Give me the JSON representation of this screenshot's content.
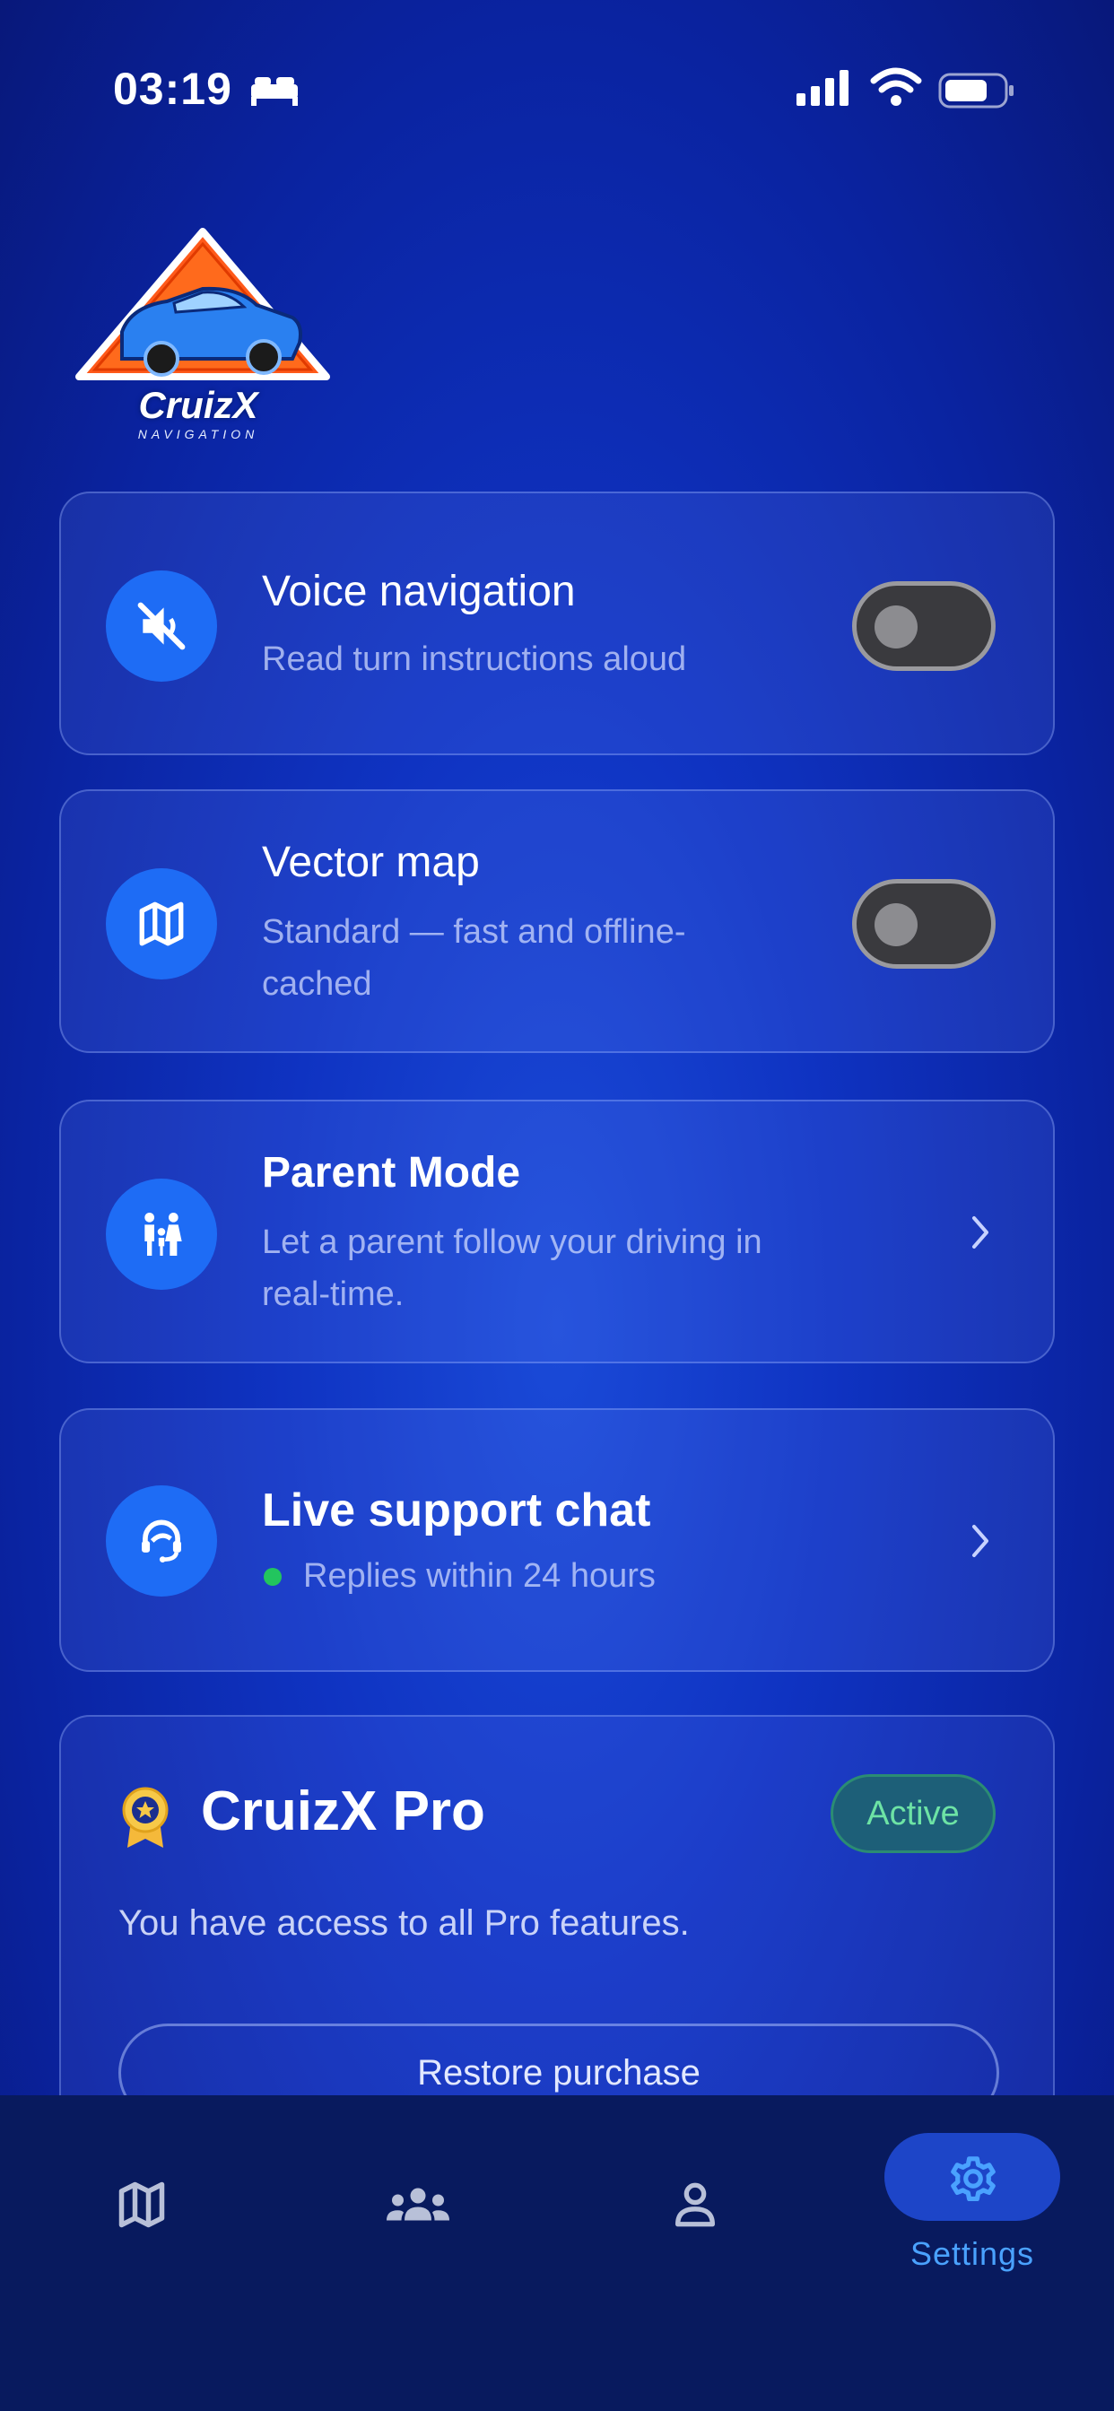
{
  "status_bar": {
    "time": "03:19"
  },
  "logo": {
    "title": "CruizX",
    "subtitle": "NAVIGATION"
  },
  "settings": [
    {
      "title": "Voice navigation",
      "subtitle": "Read turn instructions aloud",
      "control": "toggle",
      "enabled": false,
      "icon": "speaker-muted-icon"
    },
    {
      "title": "Vector map",
      "subtitle": "Standard — fast and offline-cached",
      "subtitle_lines": [
        "Standard — fast and offline-",
        "cached"
      ],
      "control": "toggle",
      "enabled": false,
      "icon": "map-icon"
    },
    {
      "title": "Parent Mode",
      "subtitle_lines": [
        "Let a parent follow your driving in",
        "real-time."
      ],
      "control": "chevron",
      "icon": "family-icon"
    },
    {
      "title": "Live support chat",
      "subtitle": "Replies within 24 hours",
      "status_color": "#22c55e",
      "control": "chevron",
      "icon": "support-agent-icon"
    }
  ],
  "pro": {
    "title": "CruizX Pro",
    "badge": "Active",
    "description": "You have access to all Pro features.",
    "restore_label": "Restore purchase",
    "icon": "award-icon"
  },
  "tabbar": {
    "tabs": [
      {
        "icon": "map-icon",
        "label": "",
        "active": false
      },
      {
        "icon": "group-icon",
        "label": "",
        "active": false
      },
      {
        "icon": "person-icon",
        "label": "",
        "active": false
      },
      {
        "icon": "gear-icon",
        "label": "Settings",
        "active": true
      }
    ]
  },
  "colors": {
    "accent": "#1e6cf5",
    "active_tab": "#4aa2ff",
    "badge_text": "#6de3a5"
  }
}
